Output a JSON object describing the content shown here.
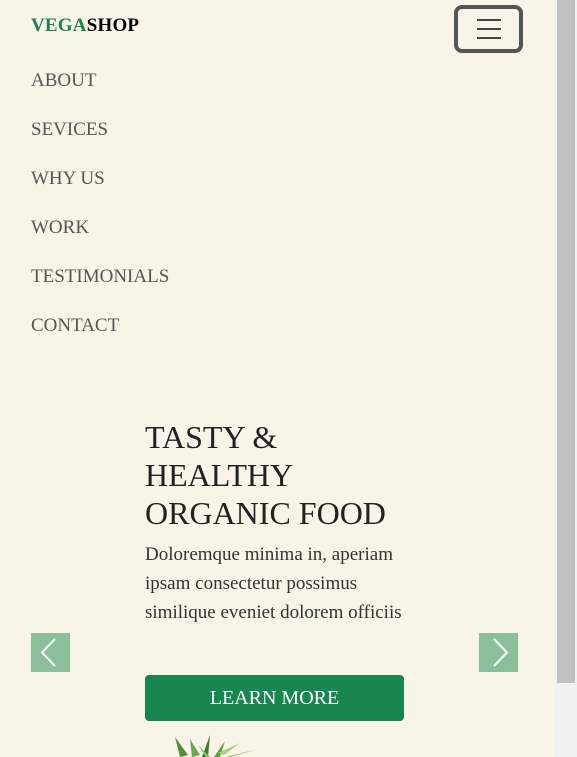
{
  "brand": {
    "part1": "VEGA",
    "part2": "SHOP",
    "accent_color": "#17864f"
  },
  "header": {
    "menu_icon": "hamburger-icon"
  },
  "nav": {
    "items": [
      {
        "label": "ABOUT"
      },
      {
        "label": "SEVICES"
      },
      {
        "label": "WHY US"
      },
      {
        "label": "WORK"
      },
      {
        "label": "TESTIMONIALS"
      },
      {
        "label": "CONTACT"
      }
    ]
  },
  "hero": {
    "title_line1": "TASTY &",
    "title_line2": "HEALTHY",
    "title_line3": "ORGANIC FOOD",
    "text": "Doloremque minima in, aperiam ipsam consectetur possimus similique eveniet dolorem officiis",
    "button_label": "LEARN MORE",
    "button_color": "#17864f"
  },
  "carousel": {
    "prev_icon": "chevron-left-icon",
    "next_icon": "chevron-right-icon",
    "arrow_color": "#8bbf9b"
  },
  "colors": {
    "background": "#faf3e8",
    "text": "#222222",
    "nav_text": "#555555"
  }
}
